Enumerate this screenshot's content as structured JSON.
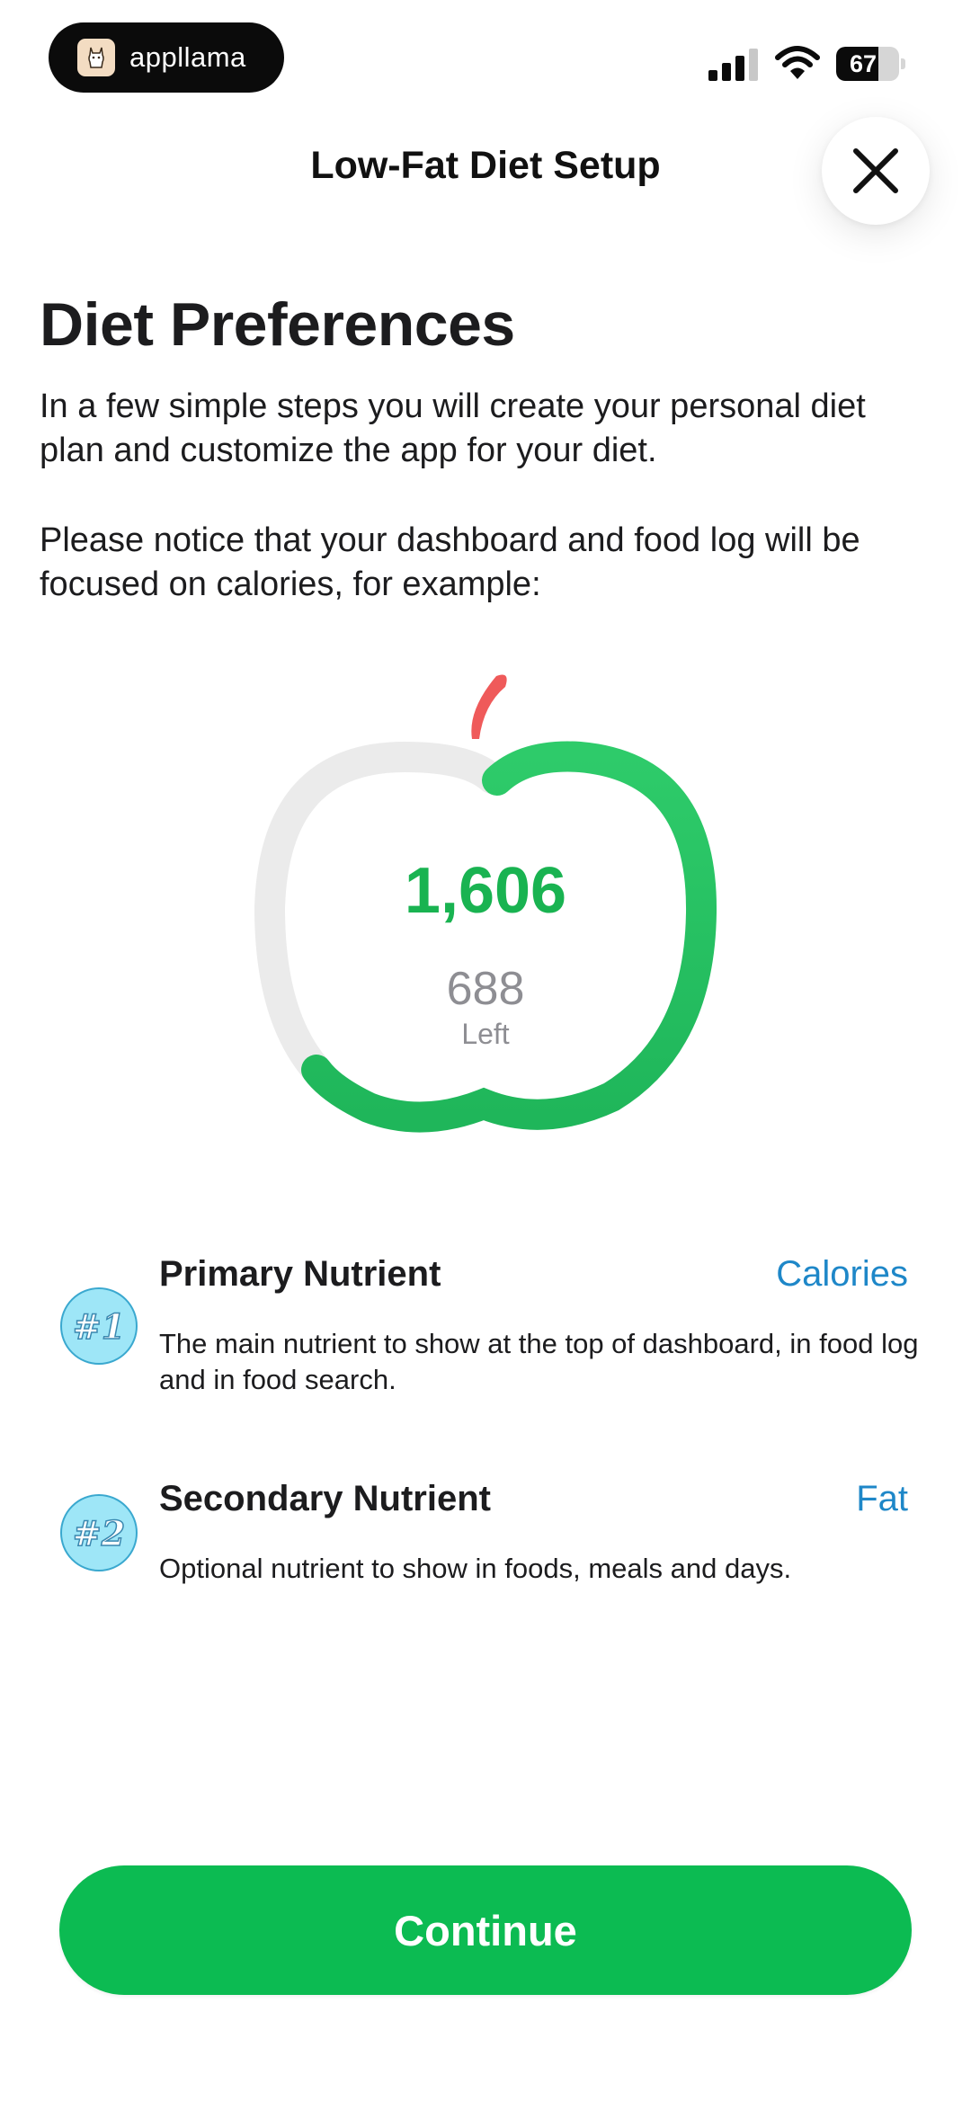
{
  "status_bar": {
    "app_name": "appllama",
    "battery_level": "67",
    "icons": [
      "app-logo-icon",
      "cellular-signal-icon",
      "wifi-icon",
      "battery-icon"
    ]
  },
  "header": {
    "title": "Low-Fat Diet Setup",
    "close_icon": "close-icon"
  },
  "intro": {
    "heading": "Diet Preferences",
    "paragraph_1": "In a few simple steps you will create your personal diet plan and customize the app for your diet.",
    "paragraph_2": "Please notice that your dashboard and food log will be focused on calories, for example:"
  },
  "example_ring": {
    "value": "1,606",
    "remaining": "688",
    "remaining_label": "Left",
    "progress_fraction": 0.7,
    "colors": {
      "progress": "#19b351",
      "track": "#ebebeb",
      "stem": "#ef5a5a"
    }
  },
  "nutrients": [
    {
      "rank": "#1",
      "title": "Primary Nutrient",
      "value": "Calories",
      "description": "The main nutrient to show at the top of dashboard, in food log and in food search."
    },
    {
      "rank": "#2",
      "title": "Secondary Nutrient",
      "value": "Fat",
      "description": "Optional nutrient to show in foods, meals and days."
    }
  ],
  "actions": {
    "continue_label": "Continue"
  },
  "colors": {
    "accent": "#0cbb52",
    "link": "#1e87c8",
    "badge_fill": "#9ee6f7",
    "badge_stroke": "#3aa8cf"
  }
}
